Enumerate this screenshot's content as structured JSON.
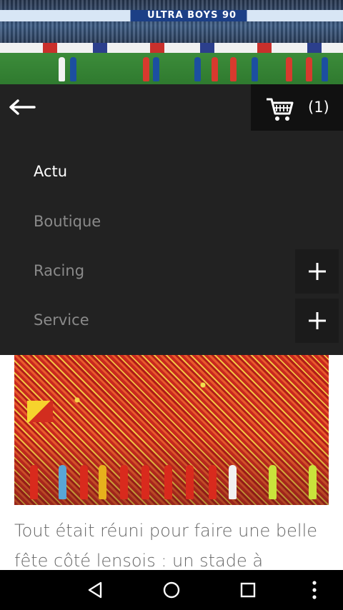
{
  "header": {
    "banner_text": "ULTRA BOYS 90"
  },
  "menu": {
    "back_icon": "arrow-left-icon",
    "cart": {
      "icon": "cart-icon",
      "count_label": "(1)"
    },
    "items": [
      {
        "label": "Actu",
        "active": true,
        "expandable": false
      },
      {
        "label": "Boutique",
        "active": false,
        "expandable": false
      },
      {
        "label": "Racing",
        "active": false,
        "expandable": true
      },
      {
        "label": "Service",
        "active": false,
        "expandable": true
      }
    ],
    "expand_icon": "plus-icon"
  },
  "article": {
    "text": "Tout était réuni pour faire une belle fête côté lensois : un stade à guichets"
  },
  "navbar": {
    "buttons": [
      "back-triangle-icon",
      "home-circle-icon",
      "recents-square-icon",
      "overflow-dots-icon"
    ]
  },
  "colors": {
    "menu_bg": "#222222",
    "cart_bg": "#111111",
    "active_text": "#ffffff",
    "inactive_text": "#8a8a8a",
    "article_text": "#666666"
  }
}
